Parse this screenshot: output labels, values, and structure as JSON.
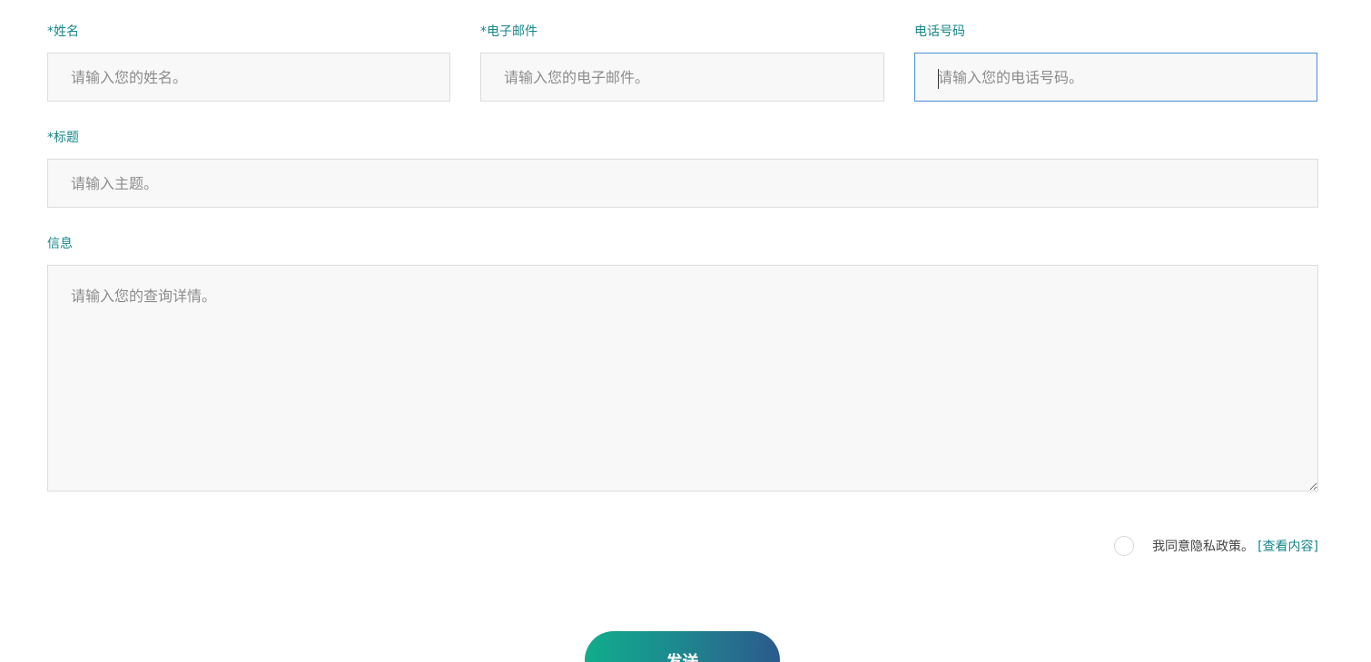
{
  "form": {
    "name": {
      "label": "*姓名",
      "placeholder": "请输入您的姓名。",
      "value": ""
    },
    "email": {
      "label": "*电子邮件",
      "placeholder": "请输入您的电子邮件。",
      "value": ""
    },
    "phone": {
      "label": "电话号码",
      "placeholder": "请输入您的电话号码。",
      "value": "",
      "focused": true
    },
    "subject": {
      "label": "*标题",
      "placeholder": "请输入主题。",
      "value": ""
    },
    "message": {
      "label": "信息",
      "placeholder": "请输入您的查询详情。",
      "value": ""
    },
    "consent": {
      "text": "我同意隐私政策。",
      "link": "[查看内容]",
      "checked": false
    },
    "submit_label": "发送"
  },
  "colors": {
    "label": "#17868a",
    "field_bg": "#f8f8f8",
    "field_border": "#dcdcdc",
    "focus_border": "#4a8fd6",
    "button_gradient_start": "#10ad8c",
    "button_gradient_end": "#2c5a8c"
  }
}
